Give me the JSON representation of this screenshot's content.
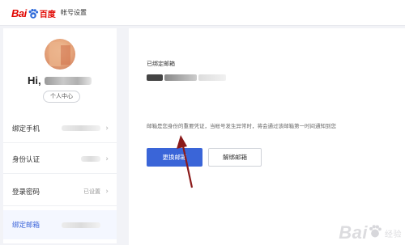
{
  "header": {
    "logo_text": "Bai",
    "logo_suffix": "百度",
    "page_title": "帐号设置"
  },
  "profile": {
    "greeting": "Hi,",
    "user_center_label": "个人中心"
  },
  "menu": [
    {
      "label": "绑定手机",
      "value": ""
    },
    {
      "label": "身份认证",
      "value": ""
    },
    {
      "label": "登录密码",
      "value": "已设置"
    },
    {
      "label": "绑定邮箱",
      "value": ""
    }
  ],
  "main": {
    "bound_label": "已绑定邮箱",
    "hint": "邮箱是您身份的重要凭证，当帐号发生异常时，将会通过该邮箱第一时间通知到您",
    "primary_button": "更换邮箱",
    "secondary_button": "解绑邮箱"
  },
  "watermark": {
    "text": "Bai",
    "sub": "经验"
  },
  "colors": {
    "accent": "#3a65d8",
    "brand_red": "#e10601",
    "arrow": "#8b1a1a"
  }
}
